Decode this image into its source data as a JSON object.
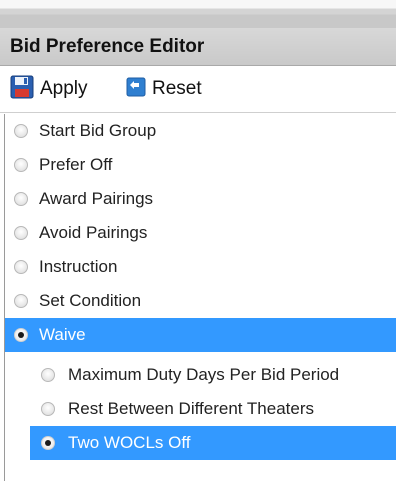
{
  "panel": {
    "title": "Bid Preference Editor"
  },
  "toolbar": {
    "apply_label": "Apply",
    "reset_label": "Reset"
  },
  "options": [
    {
      "label": "Start Bid Group",
      "selected": false
    },
    {
      "label": "Prefer Off",
      "selected": false
    },
    {
      "label": "Award Pairings",
      "selected": false
    },
    {
      "label": "Avoid Pairings",
      "selected": false
    },
    {
      "label": "Instruction",
      "selected": false
    },
    {
      "label": "Set Condition",
      "selected": false
    },
    {
      "label": "Waive",
      "selected": true
    }
  ],
  "waive_options": [
    {
      "label": "Maximum Duty Days Per Bid Period",
      "selected": false
    },
    {
      "label": "Rest Between Different Theaters",
      "selected": false
    },
    {
      "label": "Two WOCLs Off",
      "selected": true
    }
  ],
  "colors": {
    "selection": "#3399ff",
    "header_bg": "#cccccc"
  },
  "icons": {
    "apply": "save-icon",
    "reset": "reset-icon"
  }
}
